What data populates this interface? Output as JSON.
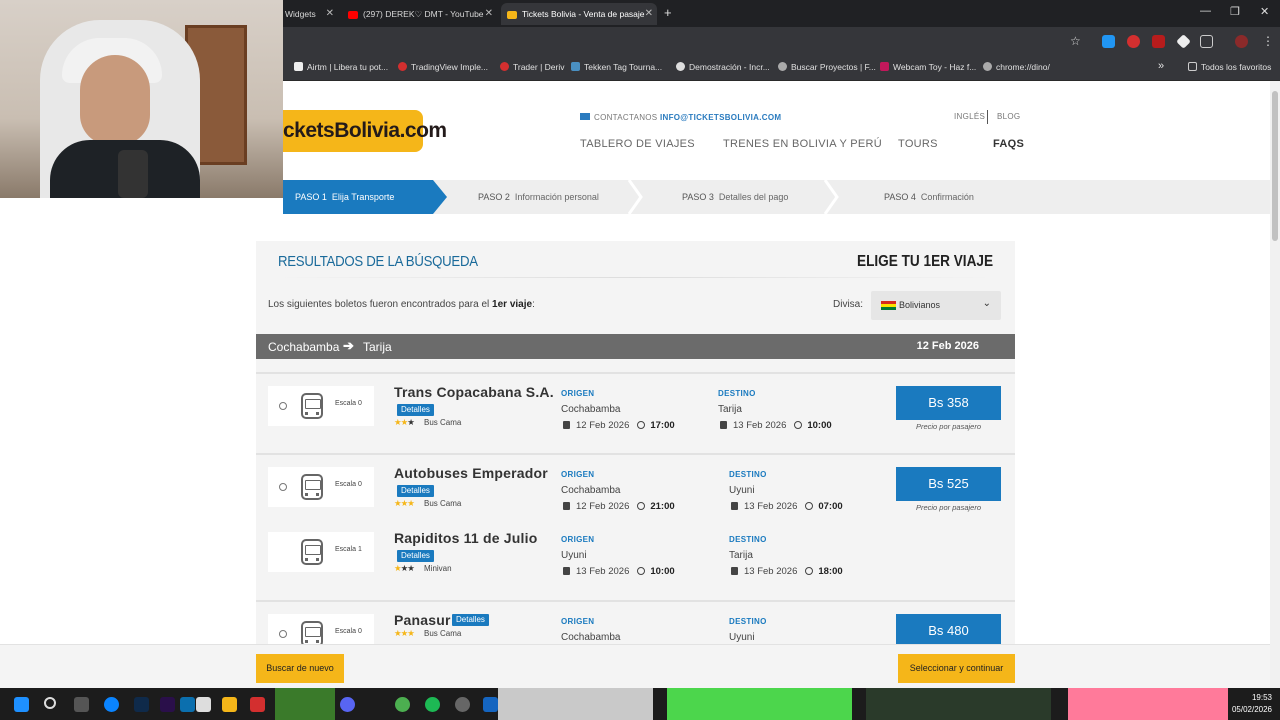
{
  "browser": {
    "tabs": [
      {
        "label": "Widgets",
        "active": false
      },
      {
        "label": "(297) DEREK♡ DMT - YouTube",
        "active": false
      },
      {
        "label": "Tickets Bolivia - Venta de pasaje",
        "active": true
      }
    ],
    "new_tab": "+",
    "bookmarks": [
      "Airtm | Libera tu pot...",
      "TradingView Imple...",
      "Trader | Deriv",
      "Tekken Tag Tourna...",
      "Demostración - Incr...",
      "Buscar Proyectos | F...",
      "Webcam Toy - Haz f...",
      "chrome://dino/"
    ],
    "bookmarks_more": "»",
    "all_bookmarks": "Todos los favoritos"
  },
  "site": {
    "logo_text": "cketsBolivia.com",
    "contact_label": "CONTACTANOS",
    "contact_email": "INFO@TICKETSBOLIVIA.COM",
    "top_links": [
      "INGLÉS",
      "BLOG"
    ],
    "nav": [
      "TABLERO DE VIAJES",
      "TRENES EN BOLIVIA Y PERÚ",
      "TOURS",
      "FAQS"
    ]
  },
  "steps": [
    {
      "num": "PASO 1",
      "label": "Elija Transporte"
    },
    {
      "num": "PASO 2",
      "label": "Información personal"
    },
    {
      "num": "PASO 3",
      "label": "Detalles del pago"
    },
    {
      "num": "PASO 4",
      "label": "Confirmación"
    }
  ],
  "results": {
    "title": "RESULTADOS DE LA BÚSQUEDA",
    "trip": "ELIGE TU 1ER VIAJE",
    "intro": "Los siguientes boletos fueron encontrados para el",
    "intro_bold": "1er viaje",
    "intro_end": ":",
    "divisa_label": "Divisa:",
    "divisa_value": "Bolivianos",
    "route": {
      "from": "Cochabamba",
      "arrow": "➔",
      "to": "Tarija",
      "date": "12 Feb 2026"
    },
    "origen_label": "ORIGEN",
    "destino_label": "DESTINO",
    "detalles_label": "Detalles",
    "per_passenger": "Precio por pasajero",
    "options": [
      {
        "price": "Bs 358",
        "legs": [
          {
            "escala": "Escala 0",
            "company": "Trans Copacabana S.A.",
            "stars": 2,
            "type": "Bus Cama",
            "origin": "Cochabamba",
            "origin_date": "12 Feb 2026",
            "origin_time": "17:00",
            "dest": "Tarija",
            "dest_date": "13 Feb 2026",
            "dest_time": "10:00"
          }
        ]
      },
      {
        "price": "Bs 525",
        "legs": [
          {
            "escala": "Escala 0",
            "company": "Autobuses Emperador",
            "stars": 3,
            "type": "Bus Cama",
            "origin": "Cochabamba",
            "origin_date": "12 Feb 2026",
            "origin_time": "21:00",
            "dest": "Uyuni",
            "dest_date": "13 Feb 2026",
            "dest_time": "07:00"
          },
          {
            "escala": "Escala 1",
            "company": "Rapiditos 11 de Julio",
            "stars": 1,
            "type": "Minivan",
            "origin": "Uyuni",
            "origin_date": "13 Feb 2026",
            "origin_time": "10:00",
            "dest": "Tarija",
            "dest_date": "13 Feb 2026",
            "dest_time": "18:00"
          }
        ]
      },
      {
        "price": "Bs 480",
        "legs": [
          {
            "escala": "Escala 0",
            "company": "Panasur",
            "stars": 3,
            "type": "Bus Cama",
            "origin": "Cochabamba",
            "dest": "Uyuni"
          }
        ]
      }
    ]
  },
  "footer": {
    "search_again": "Buscar de nuevo",
    "select_continue": "Seleccionar y continuar"
  },
  "taskbar": {
    "time": "19:53",
    "date": "05/02/2026"
  },
  "colors": {
    "brand_yellow": "#f5b619",
    "brand_blue": "#1a7abf",
    "route_bar": "#6b6b6b"
  }
}
